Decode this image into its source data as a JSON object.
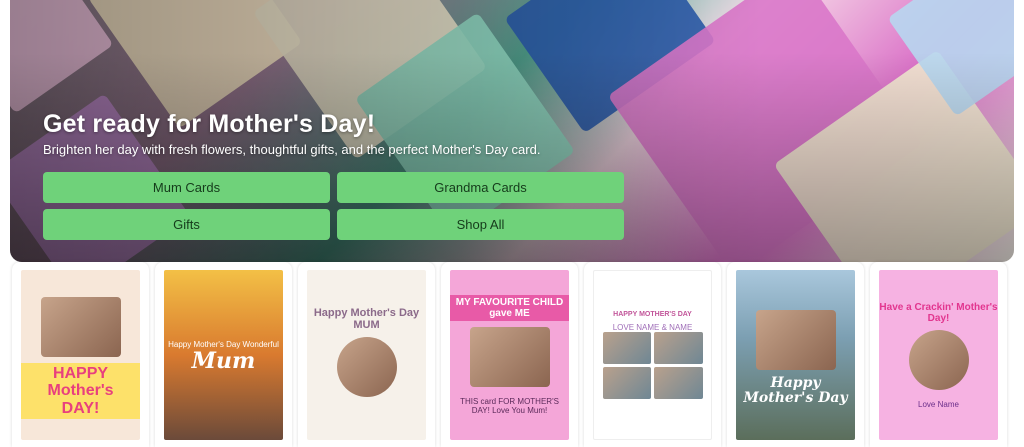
{
  "hero": {
    "title": "Get ready for Mother's Day!",
    "subtitle": "Brighten her day with fresh flowers, thoughtful gifts, and the perfect Mother's Day card.",
    "buttons": [
      {
        "label": "Mum Cards"
      },
      {
        "label": "Grandma Cards"
      },
      {
        "label": "Gifts"
      },
      {
        "label": "Shop All"
      }
    ],
    "button_color": "#6fd27a"
  },
  "cards": [
    {
      "headline": "HAPPY Mother's DAY!",
      "caption": ""
    },
    {
      "headline": "Mum",
      "caption": "Happy Mother's Day Wonderful"
    },
    {
      "headline": "Happy Mother's Day MUM",
      "caption": ""
    },
    {
      "headline": "MY FAVOURITE CHILD gave ME",
      "caption": "THIS card FOR MOTHER'S DAY! Love You Mum!"
    },
    {
      "headline": "HAPPY MOTHER'S DAY",
      "caption": "LOVE NAME & NAME"
    },
    {
      "headline": "Happy Mother's Day",
      "caption": ""
    },
    {
      "headline": "Have a Crackin' Mother's Day!",
      "caption": "Love Name"
    }
  ]
}
